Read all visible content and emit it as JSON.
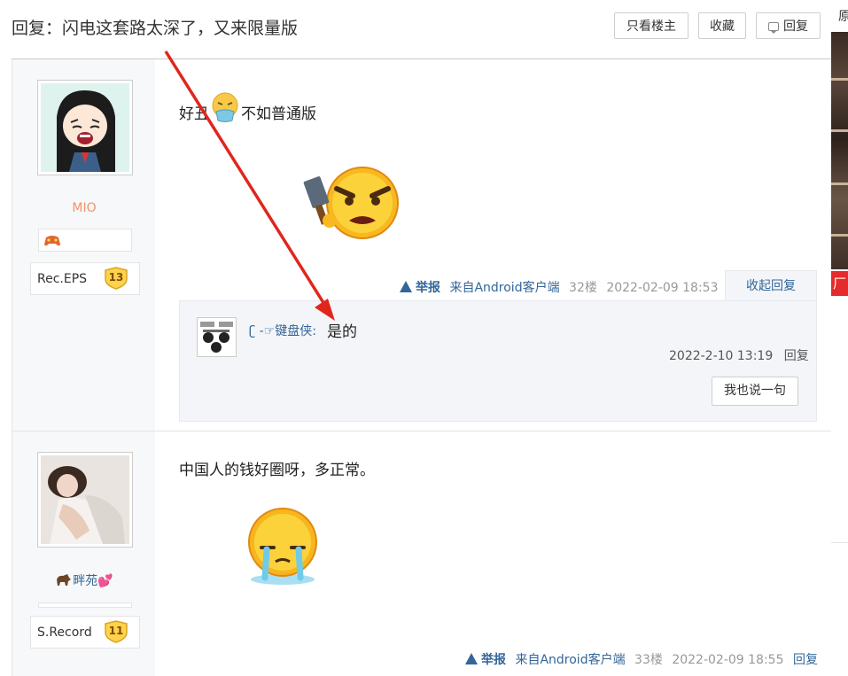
{
  "header": {
    "thread_title": "回复：闪电这套路太深了，又来限量版",
    "buttons": {
      "only_op": "只看楼主",
      "favorite": "收藏",
      "reply": "回复"
    }
  },
  "right_sidebar": {
    "top_char": "原",
    "ad_char": "厂"
  },
  "posts": [
    {
      "username": "MIO",
      "rank": "Rec.EPS",
      "level": "13",
      "content_before_emoji": "好丑",
      "content_after_emoji": "不如普通版",
      "meta": {
        "report": "举报",
        "source": "来自Android客户端",
        "floor": "32楼",
        "time": "2022-02-09 18:53"
      },
      "collapse_label": "收起回复",
      "reply": {
        "user": "ʗ -☞键盘侠:",
        "text": "是的",
        "time": "2022-2-10 13:19",
        "reply_label": "回复",
        "say_button": "我也说一句"
      }
    },
    {
      "username": "畔苑",
      "rank": "S.Record",
      "level": "11",
      "content": "中国人的钱好圈呀，多正常。",
      "meta": {
        "report": "举报",
        "source": "来自Android客户端",
        "floor": "33楼",
        "time": "2022-02-09 18:55",
        "reply": "回复"
      }
    }
  ],
  "colors": {
    "link": "#336699",
    "username_pink": "#f0936a",
    "annotation_arrow": "#e0261c"
  }
}
